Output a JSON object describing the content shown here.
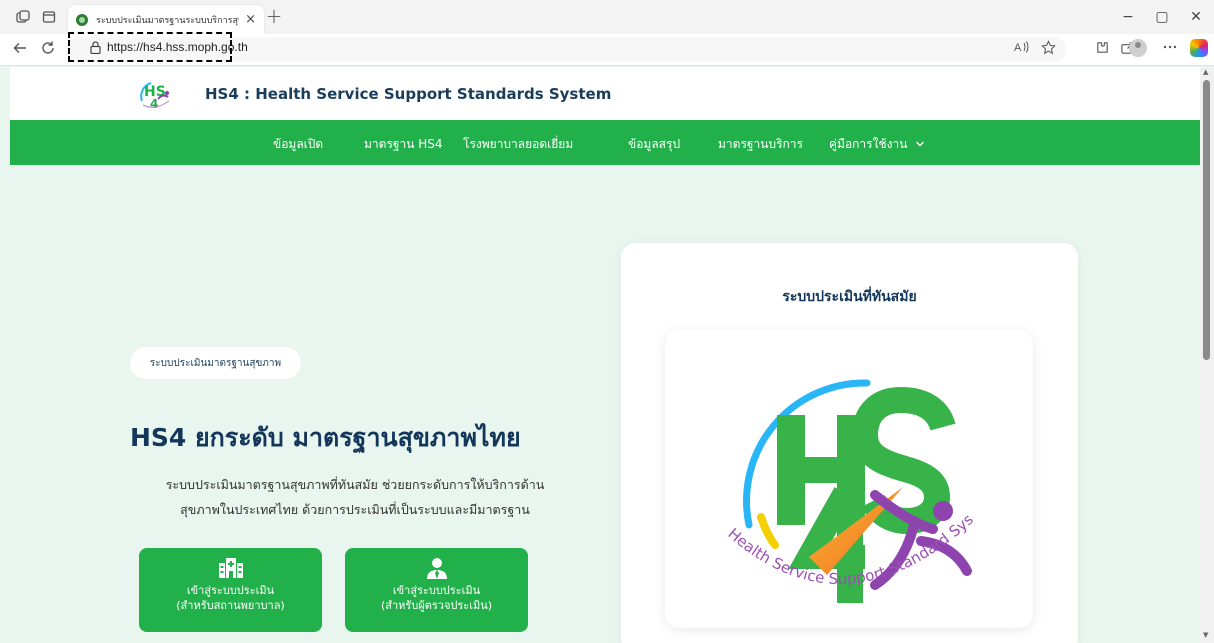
{
  "browser": {
    "tab_title": "ระบบประเมินมาตรฐานระบบบริการสุขภา",
    "tab_close": "×",
    "new_tab": "+",
    "url": "https://hs4.hss.moph.go.th",
    "window_controls": {
      "minimize": "−",
      "maximize": "▢",
      "close": "✕"
    }
  },
  "site": {
    "title": "HS4 : Health Service Support Standards System",
    "nav": [
      {
        "label": "ข้อมูลเปิด"
      },
      {
        "label": "มาตรฐาน HS4"
      },
      {
        "label": "โรงพยาบาลยอดเยี่ยม"
      },
      {
        "label": "ข้อมูลสรุป"
      },
      {
        "label": "มาตรฐานบริการ"
      },
      {
        "label": "คู่มือการใช้งาน"
      }
    ]
  },
  "hero": {
    "badge": "ระบบประเมินมาตรฐานสุขภาพ",
    "title": "HS4 ยกระดับ มาตรฐานสุขภาพไทย",
    "description_line1": "ระบบประเมินมาตรฐานสุขภาพที่ทันสมัย ช่วยยกระดับการให้บริการด้าน",
    "description_line2": "สุขภาพในประเทศไทย ด้วยการประเมินที่เป็นระบบและมีมาตรฐาน",
    "buttons": [
      {
        "line1": "เข้าสู่ระบบประเมิน",
        "line2": "(สำหรับสถานพยาบาล)",
        "icon": "hospital-icon"
      },
      {
        "line1": "เข้าสู่ระบบประเมิน",
        "line2": "(สำหรับผู้ตรวจประเมิน)",
        "icon": "user-icon"
      }
    ],
    "card_title": "ระบบประเมินที่ทันสมัย",
    "logo_text": "Health Service Support Standard System"
  },
  "colors": {
    "brand_green": "#22b04b",
    "navy": "#13365a",
    "hero_bg": "#e8f6ef"
  }
}
